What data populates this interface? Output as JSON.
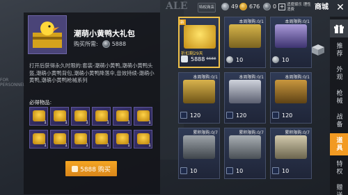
{
  "background": {
    "sign_text": "ALE",
    "sign2_text": "FOR PERSONNEL"
  },
  "topbar": {
    "badge": "特权商店",
    "currencies": [
      {
        "name": "silver",
        "value": "49"
      },
      {
        "name": "gold",
        "value": "676"
      },
      {
        "name": "uc",
        "value": "0"
      }
    ],
    "notice": "适度娱乐 理性消费",
    "title": "商城",
    "close": "✕"
  },
  "sidenav": {
    "items": [
      {
        "label": "推荐",
        "active": false
      },
      {
        "label": "外观",
        "active": false
      },
      {
        "label": "枪械",
        "active": false
      },
      {
        "label": "战备",
        "active": false
      },
      {
        "label": "道具",
        "active": true
      },
      {
        "label": "特权",
        "active": false
      },
      {
        "label": "赠送",
        "active": false
      }
    ]
  },
  "detail": {
    "title": "潮萌小黄鸭大礼包",
    "price_label": "购买所需:",
    "price_value": "5888",
    "description": "打开后获得永久时限的:套装-潮萌小黄鸭,潮萌小黄鸭头盔,潮萌小黄鸭背包,潮萌小黄鸭降落伞,音效持续-潮萌小黄鸭,潮萌小黄鸭枪械系列",
    "contains_title": "必得物品:",
    "items": [
      {
        "qty": "1"
      },
      {
        "qty": "1"
      },
      {
        "qty": "1"
      },
      {
        "qty": "1"
      },
      {
        "qty": "1"
      },
      {
        "qty": "1"
      },
      {
        "qty": "1"
      },
      {
        "qty": "1"
      },
      {
        "qty": "1"
      },
      {
        "qty": "1"
      },
      {
        "qty": "1"
      },
      {
        "qty": "1"
      }
    ],
    "buy_label": "5888 购买"
  },
  "cards": [
    {
      "limit": "",
      "ribbon": "新",
      "discount": "折扣剩29天",
      "price": "5888",
      "old": "6688",
      "currency": "uc",
      "selected": true,
      "color": "#e9b629"
    },
    {
      "limit": "本周限购:0/1",
      "ribbon": "",
      "discount": "",
      "price": "10",
      "old": "",
      "currency": "silver",
      "selected": false,
      "color": "#b99a3a"
    },
    {
      "limit": "本周限购:0/1",
      "ribbon": "",
      "discount": "",
      "price": "10",
      "old": "",
      "currency": "silver",
      "selected": false,
      "color": "#7c6aa8"
    },
    {
      "limit": "本周限购:0/1",
      "ribbon": "",
      "discount": "",
      "price": "120",
      "old": "",
      "currency": "voucher",
      "selected": false,
      "color": "#b08f3a"
    },
    {
      "limit": "本周限购:0/1",
      "ribbon": "",
      "discount": "",
      "price": "120",
      "old": "",
      "currency": "voucher",
      "selected": false,
      "color": "#8f93a6"
    },
    {
      "limit": "本周限购:0/1",
      "ribbon": "",
      "discount": "",
      "price": "120",
      "old": "",
      "currency": "voucher",
      "selected": false,
      "color": "#a07a32"
    },
    {
      "limit": "累积限购:0/7",
      "ribbon": "",
      "discount": "",
      "price": "10",
      "old": "",
      "currency": "voucher",
      "selected": false,
      "color": "#7b8289"
    },
    {
      "limit": "累积限购:0/7",
      "ribbon": "",
      "discount": "",
      "price": "10",
      "old": "",
      "currency": "voucher",
      "selected": false,
      "color": "#858d94"
    },
    {
      "limit": "累积限购:0/7",
      "ribbon": "",
      "discount": "",
      "price": "10",
      "old": "",
      "currency": "voucher",
      "selected": false,
      "color": "#b1a98e"
    }
  ]
}
